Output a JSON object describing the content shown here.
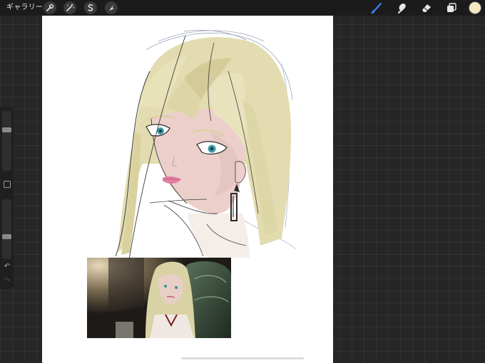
{
  "toolbar": {
    "gallery_label": "ギャラリー",
    "actions_icon": "wrench-icon",
    "adjustments_icon": "magic-wand-icon",
    "selection_icon": "selection-s-icon",
    "transform_icon": "arrow-cursor-icon",
    "brush_icon": "brush-icon",
    "smudge_icon": "smudge-icon",
    "eraser_icon": "eraser-icon",
    "layers_icon": "layers-icon",
    "active_tool": "brush",
    "active_color": "#f3eac4",
    "accent_color": "#3d7ff0"
  },
  "sidebar": {
    "brush_size_level": 0.06,
    "opacity_level": 0.74,
    "modify_icon": "square-icon",
    "undo_icon": "undo-icon",
    "redo_icon": "redo-icon",
    "undo_glyph": "↶",
    "redo_glyph": "↷"
  },
  "canvas": {
    "content": "illustration-of-blonde-anime-woman-with-earring",
    "reference_image": "screenshot-of-blonde-character-in-dark-room"
  }
}
